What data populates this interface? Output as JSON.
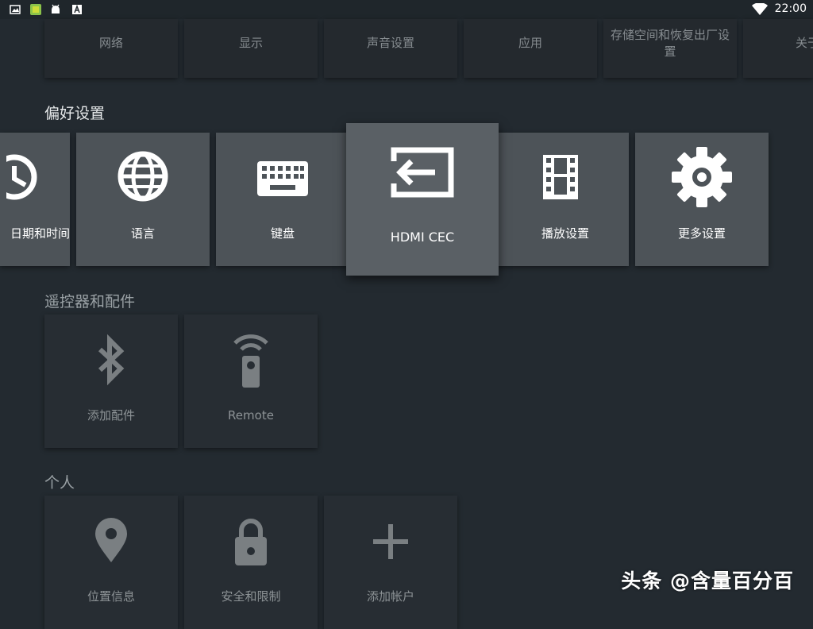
{
  "status_bar": {
    "time": "22:00",
    "icons": [
      "gallery-icon",
      "app-icon",
      "android-icon",
      "font-icon",
      "wifi-icon"
    ]
  },
  "top_row": {
    "items": [
      {
        "label": "网络"
      },
      {
        "label": "显示"
      },
      {
        "label": "声音设置"
      },
      {
        "label": "应用"
      },
      {
        "label": "存储空间和恢复出厂设置"
      },
      {
        "label": "关于"
      }
    ]
  },
  "preferences": {
    "title": "偏好设置",
    "items": [
      {
        "label": "日期和时间",
        "icon": "clock-icon"
      },
      {
        "label": "语言",
        "icon": "globe-icon"
      },
      {
        "label": "键盘",
        "icon": "keyboard-icon"
      },
      {
        "label": "HDMI CEC",
        "icon": "input-icon",
        "focused": true
      },
      {
        "label": "播放设置",
        "icon": "film-icon"
      },
      {
        "label": "更多设置",
        "icon": "gear-icon"
      }
    ]
  },
  "remotes": {
    "title": "遥控器和配件",
    "items": [
      {
        "label": "添加配件",
        "icon": "bluetooth-icon"
      },
      {
        "label": "Remote",
        "icon": "remote-icon"
      }
    ]
  },
  "personal": {
    "title": "个人",
    "items": [
      {
        "label": "位置信息",
        "icon": "location-icon"
      },
      {
        "label": "安全和限制",
        "icon": "lock-icon"
      },
      {
        "label": "添加帐户",
        "icon": "plus-icon"
      }
    ]
  },
  "watermark": "头条 @含量百分百"
}
